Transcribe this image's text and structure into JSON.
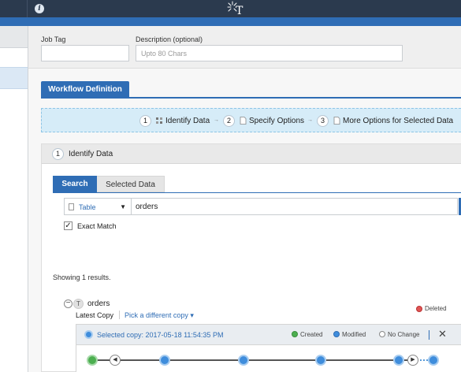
{
  "header": {
    "info_icon": "info-icon",
    "logo_icon": "sparkle-t-logo",
    "info_glyph": "i",
    "logo_letter": "T"
  },
  "form": {
    "job_tag_label": "Job Tag",
    "job_tag_value": "",
    "description_label": "Description (optional)",
    "description_placeholder": "Upto 80 Chars"
  },
  "workflow": {
    "tab_label": "Workflow Definition",
    "steps": [
      {
        "number": "1",
        "label": "Identify Data",
        "icon": "identify-data-icon"
      },
      {
        "number": "2",
        "label": "Specify Options",
        "icon": "document-icon"
      },
      {
        "number": "3",
        "label": "More Options for Selected Data",
        "icon": "document-icon"
      }
    ],
    "arrow_glyph": "→"
  },
  "identify": {
    "number": "1",
    "title": "Identify Data",
    "tabs": [
      {
        "label": "Search",
        "active": true
      },
      {
        "label": "Selected Data",
        "active": false
      }
    ],
    "object_type": "Table",
    "search_value": "orders",
    "exact_match_label": "Exact Match",
    "exact_match_checked": true,
    "check_glyph": "✓",
    "results_text": "Showing 1 results.",
    "result": {
      "collapse_glyph": "−",
      "type_badge": "T",
      "name": "orders",
      "latest_copy_label": "Latest Copy",
      "pick_label": "Pick a different copy",
      "pick_caret": "▾",
      "selected_copy_text": "Selected copy: 2017-05-18 11:54:35 PM",
      "close_glyph": "✕",
      "legend": [
        {
          "label": "Created",
          "color": "#4caf50"
        },
        {
          "label": "Modified",
          "color": "#3f8ddc"
        },
        {
          "label": "No Change",
          "color": "#ffffff"
        },
        {
          "label": "Deleted",
          "color": "#e05555"
        }
      ],
      "timeline_nav": {
        "prev": "◀",
        "next": "▶"
      }
    }
  },
  "colors": {
    "accent": "#2f6db5",
    "topbar": "#2b3a4e",
    "stepbar": "#d6ecf8"
  }
}
